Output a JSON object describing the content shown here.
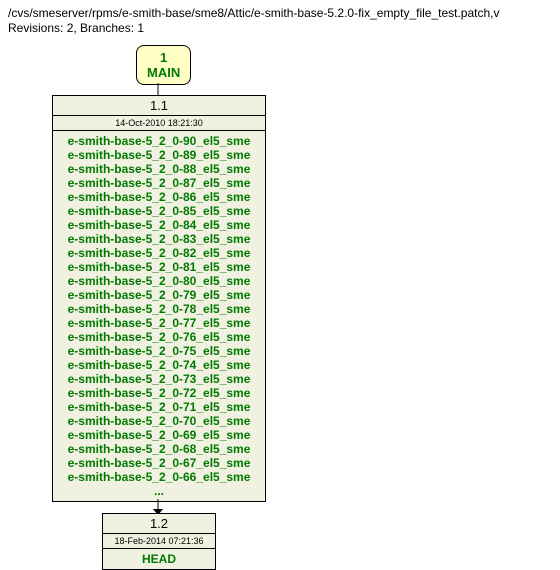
{
  "header": {
    "path": "/cvs/smeserver/rpms/e-smith-base/sme8/Attic/e-smith-base-5.2.0-fix_empty_file_test.patch,v",
    "meta": "Revisions: 2, Branches: 1"
  },
  "branch": {
    "index": "1",
    "name": "MAIN"
  },
  "node1": {
    "version": "1.1",
    "timestamp": "14-Oct-2010 18:21:30",
    "tags": [
      "e-smith-base-5_2_0-90_el5_sme",
      "e-smith-base-5_2_0-89_el5_sme",
      "e-smith-base-5_2_0-88_el5_sme",
      "e-smith-base-5_2_0-87_el5_sme",
      "e-smith-base-5_2_0-86_el5_sme",
      "e-smith-base-5_2_0-85_el5_sme",
      "e-smith-base-5_2_0-84_el5_sme",
      "e-smith-base-5_2_0-83_el5_sme",
      "e-smith-base-5_2_0-82_el5_sme",
      "e-smith-base-5_2_0-81_el5_sme",
      "e-smith-base-5_2_0-80_el5_sme",
      "e-smith-base-5_2_0-79_el5_sme",
      "e-smith-base-5_2_0-78_el5_sme",
      "e-smith-base-5_2_0-77_el5_sme",
      "e-smith-base-5_2_0-76_el5_sme",
      "e-smith-base-5_2_0-75_el5_sme",
      "e-smith-base-5_2_0-74_el5_sme",
      "e-smith-base-5_2_0-73_el5_sme",
      "e-smith-base-5_2_0-72_el5_sme",
      "e-smith-base-5_2_0-71_el5_sme",
      "e-smith-base-5_2_0-70_el5_sme",
      "e-smith-base-5_2_0-69_el5_sme",
      "e-smith-base-5_2_0-68_el5_sme",
      "e-smith-base-5_2_0-67_el5_sme",
      "e-smith-base-5_2_0-66_el5_sme",
      "..."
    ]
  },
  "node2": {
    "version": "1.2",
    "timestamp": "18-Feb-2014 07:21:36",
    "tags": [
      "HEAD"
    ]
  }
}
